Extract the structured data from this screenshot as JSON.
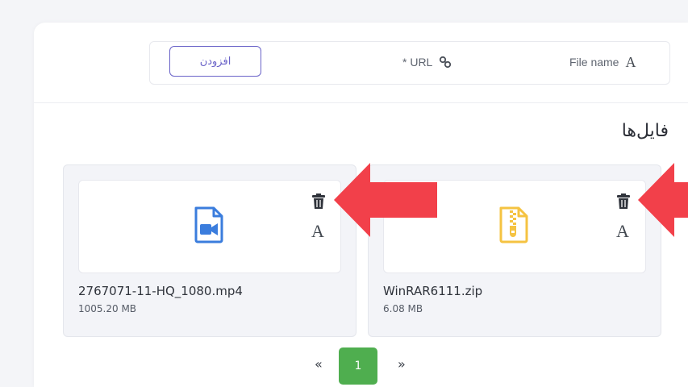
{
  "form": {
    "add_button_label": "افزودن",
    "url_label": "* URL",
    "file_name_label": "File name",
    "url_icon": "link-icon",
    "file_name_icon": "font-icon"
  },
  "section": {
    "title": "فایل‌ها"
  },
  "files": [
    {
      "name": "2767071-11-HQ_1080.mp4",
      "size": "1005.20 MB",
      "icon": "video-file-icon",
      "icon_color": "#3b7ddd"
    },
    {
      "name": "WinRAR6111.zip",
      "size": "6.08 MB",
      "icon": "zip-file-icon",
      "icon_color": "#f5c342"
    }
  ],
  "tile_actions": {
    "delete_icon": "trash-icon",
    "rename_glyph": "A"
  },
  "pagination": {
    "prev": "«",
    "current": "1",
    "next": "»"
  },
  "colors": {
    "accent": "#6a63c8",
    "page_active": "#4fae4f",
    "annotation_arrow": "#f2404a"
  }
}
